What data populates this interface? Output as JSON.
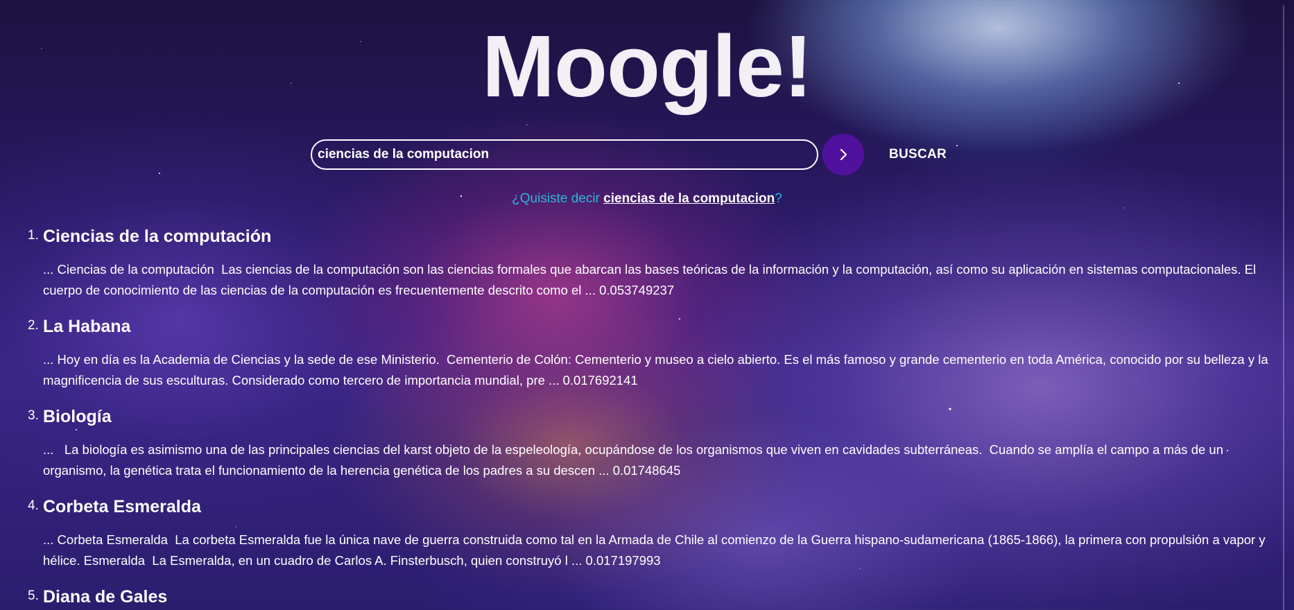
{
  "app": {
    "logo": "Moogle!"
  },
  "search": {
    "query": "ciencias de la computacion",
    "button_label": "BUSCAR",
    "go_icon": "chevron-right-icon"
  },
  "suggestion": {
    "prefix": "¿Quisiste decir ",
    "term": "ciencias de la computacion",
    "suffix": "?"
  },
  "colors": {
    "accent": "#51119f",
    "suggestion_text": "#2ab8d8"
  },
  "results": [
    {
      "number": "1.",
      "title": "Ciencias de la computación",
      "snippet": "... Ciencias de la computación  Las ciencias de la computación son las ciencias formales que abarcan las bases teóricas de la información y la computación, así como su aplicación en sistemas computacionales. El cuerpo de conocimiento de las ciencias de la computación es frecuentemente descrito como el ... 0.053749237"
    },
    {
      "number": "2.",
      "title": "La Habana",
      "snippet": "... Hoy en día es la Academia de Ciencias y la sede de ese Ministerio.  Cementerio de Colón: Cementerio y museo a cielo abierto. Es el más famoso y grande cementerio en toda América, conocido por su belleza y la magnificencia de sus esculturas. Considerado como tercero de importancia mundial, pre ... 0.017692141"
    },
    {
      "number": "3.",
      "title": "Biología",
      "snippet": "...   La biología es asimismo una de las principales ciencias del karst objeto de la espeleología, ocupándose de los organismos que viven en cavidades subterráneas.  Cuando se amplía el campo a más de un organismo, la genética trata el funcionamiento de la herencia genética de los padres a su descen ... 0.01748645"
    },
    {
      "number": "4.",
      "title": "Corbeta Esmeralda",
      "snippet": "... Corbeta Esmeralda  La corbeta Esmeralda fue la única nave de guerra construida como tal en la Armada de Chile al comienzo de la Guerra hispano-sudamericana (1865-1866), la primera con propulsión a vapor y hélice. Esmeralda  La Esmeralda, en un cuadro de Carlos A. Finsterbusch, quien construyó l ... 0.017197993"
    },
    {
      "number": "5.",
      "title": "Diana de Gales",
      "snippet": ""
    }
  ]
}
